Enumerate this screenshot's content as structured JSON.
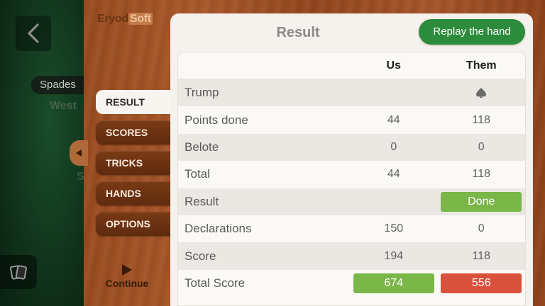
{
  "brand": {
    "part1": "Eryod",
    "part2": "Soft"
  },
  "game": {
    "trump_pill": "Spades",
    "west_label": "West",
    "south_label": "S"
  },
  "menu": [
    {
      "label": "RESULT",
      "active": true
    },
    {
      "label": "SCORES",
      "active": false
    },
    {
      "label": "TRICKS",
      "active": false
    },
    {
      "label": "HANDS",
      "active": false
    },
    {
      "label": "OPTIONS",
      "active": false
    }
  ],
  "continue_label": "Continue",
  "panel": {
    "title": "Result",
    "replay_label": "Replay the hand",
    "columns": [
      "",
      "Us",
      "Them"
    ],
    "rows": [
      {
        "label": "Trump",
        "us": "",
        "them_icon": "spade-icon"
      },
      {
        "label": "Points done",
        "us": "44",
        "them": "118"
      },
      {
        "label": "Belote",
        "us": "0",
        "them": "0"
      },
      {
        "label": "Total",
        "us": "44",
        "them": "118"
      },
      {
        "label": "Result",
        "us": "",
        "them": "Done"
      },
      {
        "label": "Declarations",
        "us": "150",
        "them": "0"
      },
      {
        "label": "Score",
        "us": "194",
        "them": "118"
      },
      {
        "label": "Total Score",
        "us": "674",
        "them": "556"
      }
    ]
  },
  "colors": {
    "replay_green": "#2d8c3b",
    "done_green": "#7ab648",
    "us_total_green": "#7ab648",
    "them_total_red": "#d9503b",
    "wood": "#a0522d",
    "menu_brown": "#6b3212"
  }
}
